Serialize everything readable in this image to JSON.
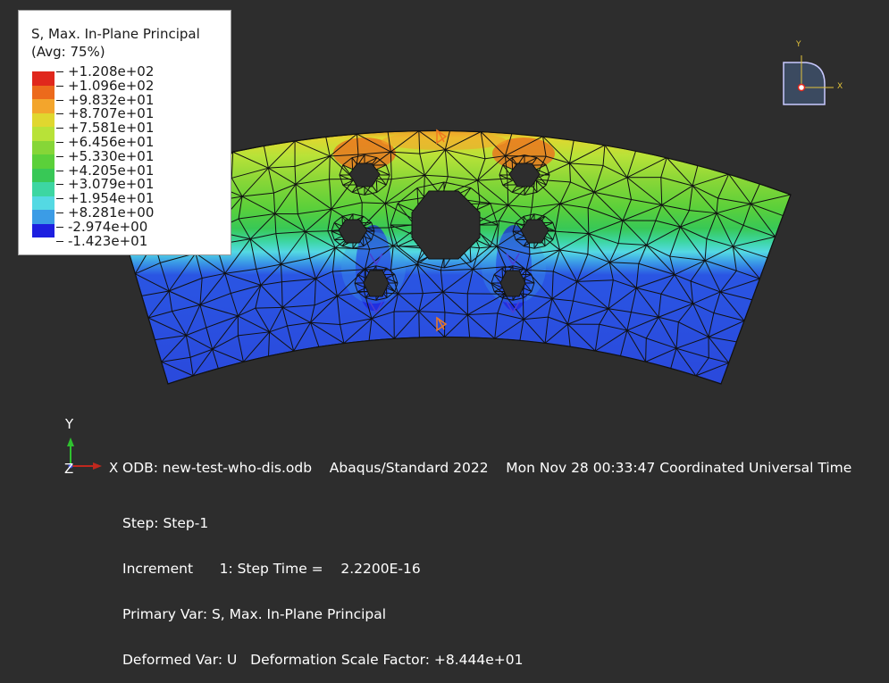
{
  "legend": {
    "title": "S, Max. In-Plane Principal",
    "subtitle": "(Avg: 75%)",
    "entries": [
      {
        "label": "+1.208e+02",
        "color": "#e0271c"
      },
      {
        "label": "+1.096e+02",
        "color": "#ec6a1c"
      },
      {
        "label": "+9.832e+01",
        "color": "#f3a52c"
      },
      {
        "label": "+8.707e+01",
        "color": "#e0d72f"
      },
      {
        "label": "+7.581e+01",
        "color": "#b8e238"
      },
      {
        "label": "+6.456e+01",
        "color": "#86d637"
      },
      {
        "label": "+5.330e+01",
        "color": "#5bd03a"
      },
      {
        "label": "+4.205e+01",
        "color": "#38c856"
      },
      {
        "label": "+3.079e+01",
        "color": "#3dd6a2"
      },
      {
        "label": "+1.954e+01",
        "color": "#54d9e3"
      },
      {
        "label": "+8.281e+00",
        "color": "#3b9ce6"
      },
      {
        "label": "-2.974e+00",
        "color": "#2a55e3"
      },
      {
        "label": "-1.423e+01",
        "color": "#1d1fe0"
      }
    ]
  },
  "info": {
    "odb_line": "ODB: new-test-who-dis.odb    Abaqus/Standard 2022    Mon Nov 28 00:33:47 Coordinated Universal Time",
    "step_line": "Step: Step-1",
    "increment_line": "Increment      1: Step Time =    2.2200E-16",
    "primary_var_line": "Primary Var: S, Max. In-Plane Principal",
    "deformed_var_line": "Deformed Var: U   Deformation Scale Factor: +8.444e+01"
  },
  "triad": {
    "x_label": "X",
    "y_label": "Y",
    "z_label": "Z"
  },
  "view_cube": {
    "x_label": "X",
    "y_label": "Y"
  },
  "colors": {
    "background": "#2d2d2d",
    "mesh_lines": "#111111",
    "boundary_marker": "#f07a20"
  }
}
